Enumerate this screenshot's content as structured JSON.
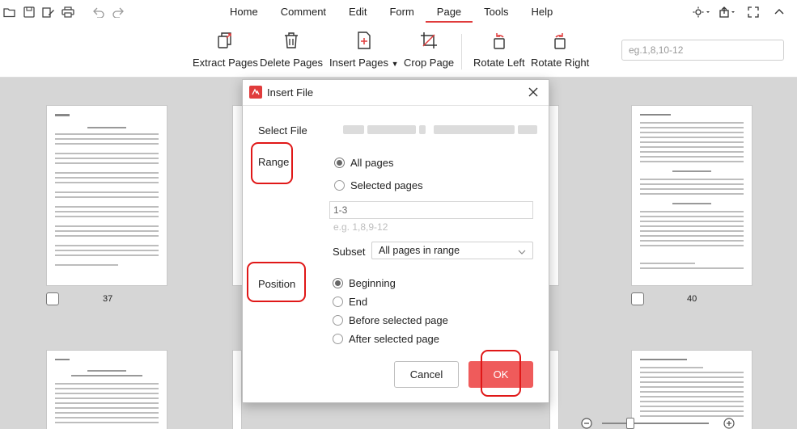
{
  "colors": {
    "accent": "#e03c3c",
    "ok_button": "#ef5b5b",
    "annotation": "#e01818"
  },
  "quick_access": {
    "icons": [
      "open-folder-icon",
      "save-icon",
      "edit-icon",
      "print-icon",
      "undo-icon",
      "redo-icon"
    ]
  },
  "menu": {
    "items": [
      {
        "label": "Home"
      },
      {
        "label": "Comment"
      },
      {
        "label": "Edit"
      },
      {
        "label": "Form"
      },
      {
        "label": "Page",
        "active": true
      },
      {
        "label": "Tools"
      },
      {
        "label": "Help"
      }
    ]
  },
  "ribbon": {
    "extract_pages": "Extract Pages",
    "delete_pages": "Delete Pages",
    "insert_pages": "Insert Pages",
    "crop_page": "Crop Page",
    "rotate_left": "Rotate Left",
    "rotate_right": "Rotate Right",
    "page_range_placeholder": "eg.1,8,10-12"
  },
  "thumbnails": {
    "page_37": "37",
    "page_40": "40"
  },
  "dialog": {
    "title": "Insert File",
    "select_file_label": "Select File",
    "range_label": "Range",
    "all_pages": "All pages",
    "selected_pages": "Selected pages",
    "range_value": "1-3",
    "range_hint": "e.g. 1,8,9-12",
    "subset_label": "Subset",
    "subset_value": "All pages in range",
    "position_label": "Position",
    "beginning": "Beginning",
    "end": "End",
    "before_selected": "Before selected page",
    "after_selected": "After selected page",
    "cancel": "Cancel",
    "ok": "OK",
    "range_selection": "all_pages",
    "position_selection": "beginning"
  }
}
